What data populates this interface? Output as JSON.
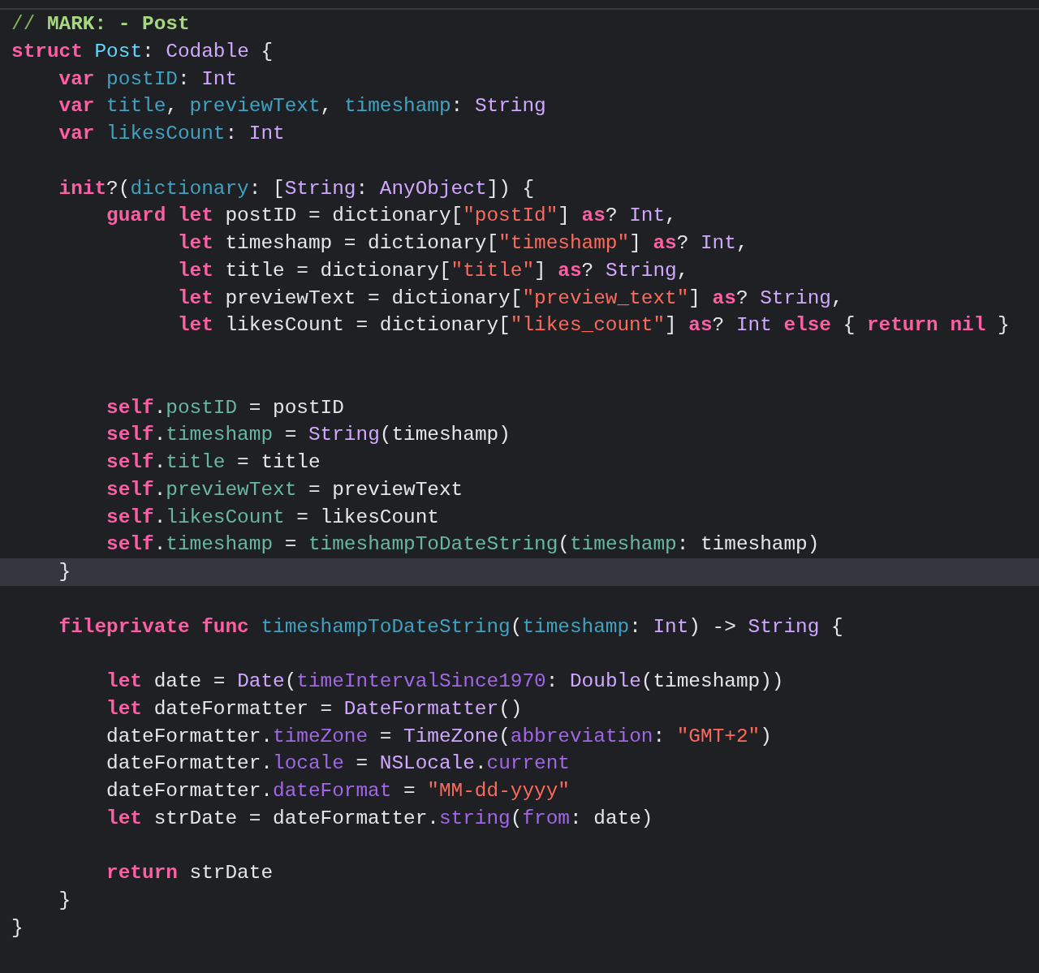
{
  "editor": {
    "lines": [
      {
        "kind": "code",
        "current": false,
        "tokens": [
          {
            "kind": "comment",
            "text": "// "
          },
          {
            "kind": "mark",
            "text": "MARK: - Post"
          }
        ]
      },
      {
        "kind": "code",
        "current": false,
        "tokens": [
          {
            "kind": "keyword",
            "text": "struct "
          },
          {
            "kind": "typedecl",
            "text": "Post"
          },
          {
            "kind": "plain",
            "text": ": "
          },
          {
            "kind": "type",
            "text": "Codable"
          },
          {
            "kind": "plain",
            "text": " {"
          }
        ]
      },
      {
        "kind": "code",
        "current": false,
        "tokens": [
          {
            "kind": "keyword",
            "text": "    var "
          },
          {
            "kind": "decl",
            "text": "postID"
          },
          {
            "kind": "plain",
            "text": ": "
          },
          {
            "kind": "type",
            "text": "Int"
          }
        ]
      },
      {
        "kind": "code",
        "current": false,
        "tokens": [
          {
            "kind": "keyword",
            "text": "    var "
          },
          {
            "kind": "decl",
            "text": "title"
          },
          {
            "kind": "plain",
            "text": ", "
          },
          {
            "kind": "decl",
            "text": "previewText"
          },
          {
            "kind": "plain",
            "text": ", "
          },
          {
            "kind": "decl",
            "text": "timeshamp"
          },
          {
            "kind": "plain",
            "text": ": "
          },
          {
            "kind": "type",
            "text": "String"
          }
        ]
      },
      {
        "kind": "code",
        "current": false,
        "tokens": [
          {
            "kind": "keyword",
            "text": "    var "
          },
          {
            "kind": "decl",
            "text": "likesCount"
          },
          {
            "kind": "plain",
            "text": ": "
          },
          {
            "kind": "type",
            "text": "Int"
          }
        ]
      },
      {
        "kind": "blank"
      },
      {
        "kind": "code",
        "current": false,
        "tokens": [
          {
            "kind": "keyword",
            "text": "    init"
          },
          {
            "kind": "plain",
            "text": "?("
          },
          {
            "kind": "decl",
            "text": "dictionary"
          },
          {
            "kind": "plain",
            "text": ": ["
          },
          {
            "kind": "type",
            "text": "String"
          },
          {
            "kind": "plain",
            "text": ": "
          },
          {
            "kind": "type",
            "text": "AnyObject"
          },
          {
            "kind": "plain",
            "text": "]) {"
          }
        ]
      },
      {
        "kind": "code",
        "current": false,
        "tokens": [
          {
            "kind": "keyword",
            "text": "        guard let"
          },
          {
            "kind": "plain",
            "text": " postID = dictionary["
          },
          {
            "kind": "string",
            "text": "\"postId\""
          },
          {
            "kind": "plain",
            "text": "] "
          },
          {
            "kind": "keyword",
            "text": "as"
          },
          {
            "kind": "plain",
            "text": "? "
          },
          {
            "kind": "type",
            "text": "Int"
          },
          {
            "kind": "plain",
            "text": ","
          }
        ]
      },
      {
        "kind": "code",
        "current": false,
        "tokens": [
          {
            "kind": "keyword",
            "text": "              let"
          },
          {
            "kind": "plain",
            "text": " timeshamp = dictionary["
          },
          {
            "kind": "string",
            "text": "\"timeshamp\""
          },
          {
            "kind": "plain",
            "text": "] "
          },
          {
            "kind": "keyword",
            "text": "as"
          },
          {
            "kind": "plain",
            "text": "? "
          },
          {
            "kind": "type",
            "text": "Int"
          },
          {
            "kind": "plain",
            "text": ","
          }
        ]
      },
      {
        "kind": "code",
        "current": false,
        "tokens": [
          {
            "kind": "keyword",
            "text": "              let"
          },
          {
            "kind": "plain",
            "text": " title = dictionary["
          },
          {
            "kind": "string",
            "text": "\"title\""
          },
          {
            "kind": "plain",
            "text": "] "
          },
          {
            "kind": "keyword",
            "text": "as"
          },
          {
            "kind": "plain",
            "text": "? "
          },
          {
            "kind": "type",
            "text": "String"
          },
          {
            "kind": "plain",
            "text": ","
          }
        ]
      },
      {
        "kind": "code",
        "current": false,
        "tokens": [
          {
            "kind": "keyword",
            "text": "              let"
          },
          {
            "kind": "plain",
            "text": " previewText = dictionary["
          },
          {
            "kind": "string",
            "text": "\"preview_text\""
          },
          {
            "kind": "plain",
            "text": "] "
          },
          {
            "kind": "keyword",
            "text": "as"
          },
          {
            "kind": "plain",
            "text": "? "
          },
          {
            "kind": "type",
            "text": "String"
          },
          {
            "kind": "plain",
            "text": ","
          }
        ]
      },
      {
        "kind": "code",
        "current": false,
        "tokens": [
          {
            "kind": "keyword",
            "text": "              let"
          },
          {
            "kind": "plain",
            "text": " likesCount = dictionary["
          },
          {
            "kind": "string",
            "text": "\"likes_count\""
          },
          {
            "kind": "plain",
            "text": "] "
          },
          {
            "kind": "keyword",
            "text": "as"
          },
          {
            "kind": "plain",
            "text": "? "
          },
          {
            "kind": "type",
            "text": "Int "
          },
          {
            "kind": "keyword",
            "text": "else"
          },
          {
            "kind": "plain",
            "text": " { "
          },
          {
            "kind": "keyword",
            "text": "return nil"
          },
          {
            "kind": "plain",
            "text": " }"
          }
        ]
      },
      {
        "kind": "blank"
      },
      {
        "kind": "blank"
      },
      {
        "kind": "code",
        "current": false,
        "tokens": [
          {
            "kind": "keyword",
            "text": "        self"
          },
          {
            "kind": "plain",
            "text": "."
          },
          {
            "kind": "project",
            "text": "postID"
          },
          {
            "kind": "plain",
            "text": " = postID"
          }
        ]
      },
      {
        "kind": "code",
        "current": false,
        "tokens": [
          {
            "kind": "keyword",
            "text": "        self"
          },
          {
            "kind": "plain",
            "text": "."
          },
          {
            "kind": "project",
            "text": "timeshamp"
          },
          {
            "kind": "plain",
            "text": " = "
          },
          {
            "kind": "type",
            "text": "String"
          },
          {
            "kind": "plain",
            "text": "(timeshamp)"
          }
        ]
      },
      {
        "kind": "code",
        "current": false,
        "tokens": [
          {
            "kind": "keyword",
            "text": "        self"
          },
          {
            "kind": "plain",
            "text": "."
          },
          {
            "kind": "project",
            "text": "title"
          },
          {
            "kind": "plain",
            "text": " = title"
          }
        ]
      },
      {
        "kind": "code",
        "current": false,
        "tokens": [
          {
            "kind": "keyword",
            "text": "        self"
          },
          {
            "kind": "plain",
            "text": "."
          },
          {
            "kind": "project",
            "text": "previewText"
          },
          {
            "kind": "plain",
            "text": " = previewText"
          }
        ]
      },
      {
        "kind": "code",
        "current": false,
        "tokens": [
          {
            "kind": "keyword",
            "text": "        self"
          },
          {
            "kind": "plain",
            "text": "."
          },
          {
            "kind": "project",
            "text": "likesCount"
          },
          {
            "kind": "plain",
            "text": " = likesCount"
          }
        ]
      },
      {
        "kind": "code",
        "current": false,
        "tokens": [
          {
            "kind": "keyword",
            "text": "        self"
          },
          {
            "kind": "plain",
            "text": "."
          },
          {
            "kind": "project",
            "text": "timeshamp"
          },
          {
            "kind": "plain",
            "text": " = "
          },
          {
            "kind": "project",
            "text": "timeshampToDateString"
          },
          {
            "kind": "plain",
            "text": "("
          },
          {
            "kind": "project",
            "text": "timeshamp"
          },
          {
            "kind": "plain",
            "text": ": timeshamp)"
          }
        ]
      },
      {
        "kind": "code",
        "current": true,
        "tokens": [
          {
            "kind": "plain",
            "text": "    }"
          }
        ]
      },
      {
        "kind": "blank"
      },
      {
        "kind": "code",
        "current": false,
        "tokens": [
          {
            "kind": "keyword",
            "text": "    fileprivate func "
          },
          {
            "kind": "decl",
            "text": "timeshampToDateString"
          },
          {
            "kind": "plain",
            "text": "("
          },
          {
            "kind": "decl",
            "text": "timeshamp"
          },
          {
            "kind": "plain",
            "text": ": "
          },
          {
            "kind": "type",
            "text": "Int"
          },
          {
            "kind": "plain",
            "text": ") -> "
          },
          {
            "kind": "type",
            "text": "String"
          },
          {
            "kind": "plain",
            "text": " {"
          }
        ]
      },
      {
        "kind": "blank"
      },
      {
        "kind": "code",
        "current": false,
        "tokens": [
          {
            "kind": "keyword",
            "text": "        let"
          },
          {
            "kind": "plain",
            "text": " date = "
          },
          {
            "kind": "type",
            "text": "Date"
          },
          {
            "kind": "plain",
            "text": "("
          },
          {
            "kind": "member",
            "text": "timeIntervalSince1970"
          },
          {
            "kind": "plain",
            "text": ": "
          },
          {
            "kind": "type",
            "text": "Double"
          },
          {
            "kind": "plain",
            "text": "(timeshamp))"
          }
        ]
      },
      {
        "kind": "code",
        "current": false,
        "tokens": [
          {
            "kind": "keyword",
            "text": "        let"
          },
          {
            "kind": "plain",
            "text": " dateFormatter = "
          },
          {
            "kind": "type",
            "text": "DateFormatter"
          },
          {
            "kind": "plain",
            "text": "()"
          }
        ]
      },
      {
        "kind": "code",
        "current": false,
        "tokens": [
          {
            "kind": "plain",
            "text": "        dateFormatter."
          },
          {
            "kind": "member",
            "text": "timeZone"
          },
          {
            "kind": "plain",
            "text": " = "
          },
          {
            "kind": "type",
            "text": "TimeZone"
          },
          {
            "kind": "plain",
            "text": "("
          },
          {
            "kind": "member",
            "text": "abbreviation"
          },
          {
            "kind": "plain",
            "text": ": "
          },
          {
            "kind": "string",
            "text": "\"GMT+2\""
          },
          {
            "kind": "plain",
            "text": ")"
          }
        ]
      },
      {
        "kind": "code",
        "current": false,
        "tokens": [
          {
            "kind": "plain",
            "text": "        dateFormatter."
          },
          {
            "kind": "member",
            "text": "locale"
          },
          {
            "kind": "plain",
            "text": " = "
          },
          {
            "kind": "type",
            "text": "NSLocale"
          },
          {
            "kind": "plain",
            "text": "."
          },
          {
            "kind": "member",
            "text": "current"
          }
        ]
      },
      {
        "kind": "code",
        "current": false,
        "tokens": [
          {
            "kind": "plain",
            "text": "        dateFormatter."
          },
          {
            "kind": "member",
            "text": "dateFormat"
          },
          {
            "kind": "plain",
            "text": " = "
          },
          {
            "kind": "string",
            "text": "\"MM-dd-yyyy\""
          }
        ]
      },
      {
        "kind": "code",
        "current": false,
        "tokens": [
          {
            "kind": "keyword",
            "text": "        let"
          },
          {
            "kind": "plain",
            "text": " strDate = dateFormatter."
          },
          {
            "kind": "member",
            "text": "string"
          },
          {
            "kind": "plain",
            "text": "("
          },
          {
            "kind": "member",
            "text": "from"
          },
          {
            "kind": "plain",
            "text": ": date)"
          }
        ]
      },
      {
        "kind": "blank"
      },
      {
        "kind": "code",
        "current": false,
        "tokens": [
          {
            "kind": "keyword",
            "text": "        return"
          },
          {
            "kind": "plain",
            "text": " strDate"
          }
        ]
      },
      {
        "kind": "code",
        "current": false,
        "tokens": [
          {
            "kind": "plain",
            "text": "    }"
          }
        ]
      },
      {
        "kind": "code",
        "current": false,
        "tokens": [
          {
            "kind": "plain",
            "text": "}"
          }
        ]
      }
    ]
  }
}
